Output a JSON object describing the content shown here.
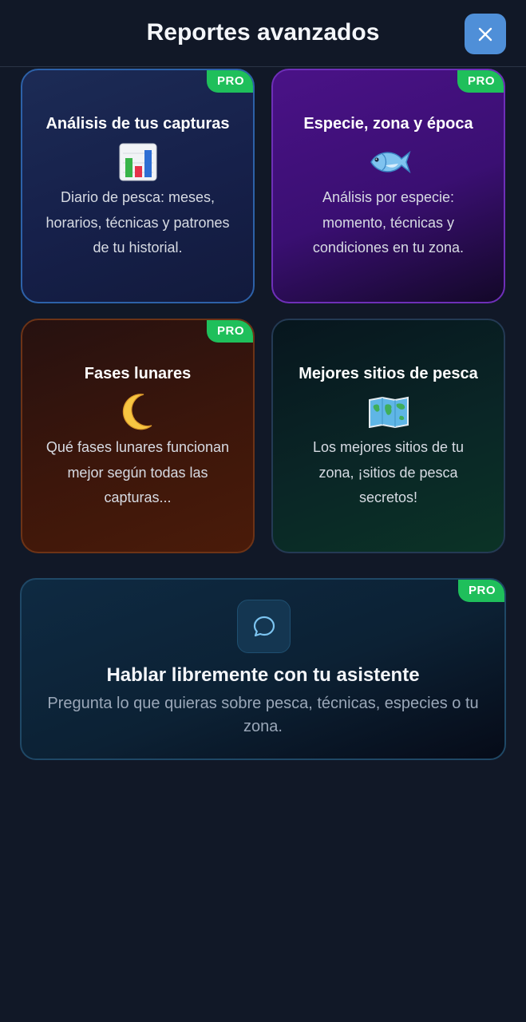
{
  "header": {
    "title": "Reportes avanzados"
  },
  "cards": [
    {
      "title": "Análisis de tus capturas",
      "badge": "PRO",
      "icon": "bar-chart-icon",
      "description": "Diario de pesca: meses, horarios, técnicas y patrones de tu historial."
    },
    {
      "title": "Especie, zona y época",
      "badge": "PRO",
      "icon": "fish-icon",
      "description": "Análisis por especie: momento, técnicas y condiciones en tu zona."
    },
    {
      "title": "Fases lunares",
      "badge": "PRO",
      "icon": "crescent-moon-icon",
      "description": "Qué fases lunares funcionan mejor según todas las capturas..."
    },
    {
      "title": "Mejores sitios de pesca",
      "badge": "",
      "icon": "world-map-icon",
      "description": "Los mejores sitios de tu zona, ¡sitios de pesca secretos!"
    }
  ],
  "assistant": {
    "title": "Hablar libremente con tu asistente",
    "description": "Pregunta lo que quieras sobre pesca, técnicas, especies o tu zona.",
    "badge": "PRO",
    "icon": "chat-bubble-icon"
  },
  "colors": {
    "background": "#111827",
    "pro_badge": "#1fbf5b",
    "close_button": "#4f8fd8"
  }
}
